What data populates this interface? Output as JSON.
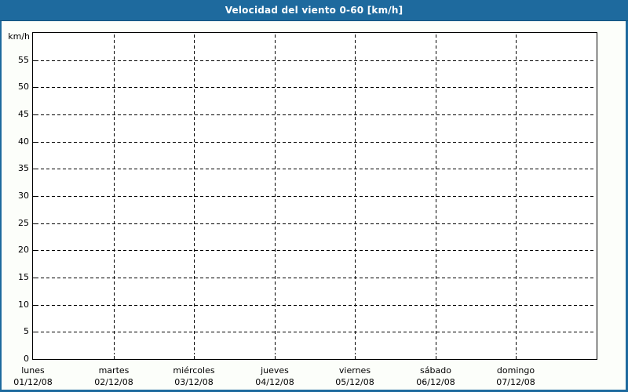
{
  "window": {
    "title": "Velocidad del viento 0-60 [km/h]"
  },
  "colors": {
    "header_bg": "#1E6A9E",
    "header_text": "#FFFFFF",
    "window_border": "#1E6A9E",
    "plot_border": "#000000",
    "grid": "#000000",
    "plot_background": "#FFFFFF",
    "outer_background": "#FCFEFA",
    "label_text": "#000000"
  },
  "chart_data": {
    "type": "line",
    "title": "Velocidad del viento 0-60 [km/h]",
    "ylabel": "km/h",
    "ylim": [
      0,
      60
    ],
    "y_ticks": [
      0,
      5,
      10,
      15,
      20,
      25,
      30,
      35,
      40,
      45,
      50,
      55
    ],
    "x_categories": [
      {
        "day": "lunes",
        "date": "01/12/08"
      },
      {
        "day": "martes",
        "date": "02/12/08"
      },
      {
        "day": "miércoles",
        "date": "03/12/08"
      },
      {
        "day": "jueves",
        "date": "04/12/08"
      },
      {
        "day": "viernes",
        "date": "05/12/08"
      },
      {
        "day": "sábado",
        "date": "06/12/08"
      },
      {
        "day": "domingo",
        "date": "07/12/08"
      }
    ],
    "series": [],
    "grid": "dashed",
    "legend": "none"
  }
}
